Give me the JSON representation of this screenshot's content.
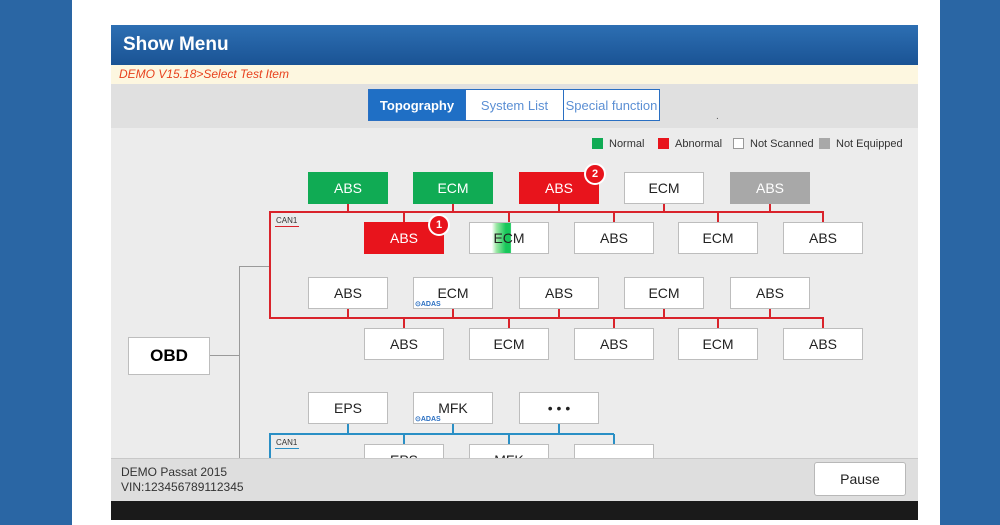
{
  "window": {
    "title": "Show Menu",
    "breadcrumb": "DEMO V15.18>Select Test Item"
  },
  "tabs": [
    {
      "label": "Topography",
      "active": true
    },
    {
      "label": "System List",
      "active": false
    },
    {
      "label": "Special function",
      "active": false
    }
  ],
  "marker": ".",
  "legend": [
    {
      "label": "Normal",
      "color": "#10ab54"
    },
    {
      "label": "Abnormal",
      "color": "#e8141c"
    },
    {
      "label": "Not Scanned",
      "color": "#ffffff"
    },
    {
      "label": "Not Equipped",
      "color": "#a8a8a8"
    }
  ],
  "topology": {
    "root": "OBD",
    "bus_label": "CAN1",
    "row1": [
      "ABS",
      "ECM",
      "ABS",
      "ECM",
      "ABS"
    ],
    "row2": [
      "ABS",
      "ECM",
      "ABS",
      "ECM",
      "ABS"
    ],
    "row3": [
      "ABS",
      "ECM",
      "ABS",
      "ECM",
      "ABS"
    ],
    "row4": [
      "ABS",
      "ECM",
      "ABS",
      "ECM",
      "ABS"
    ],
    "row5": [
      "EPS",
      "MFK",
      "• • •"
    ],
    "row6": [
      "EPS",
      "MFK",
      "• • •"
    ],
    "badge1": "1",
    "badge2": "2",
    "adas_label": "⊙ADAS"
  },
  "colors": {
    "bus_red": "#d9232b",
    "bus_blue": "#2a8fc5",
    "trunk": "#9a9a9a"
  },
  "footer": {
    "vehicle": "DEMO Passat 2015",
    "vin": "VIN:123456789112345",
    "pause_label": "Pause"
  }
}
